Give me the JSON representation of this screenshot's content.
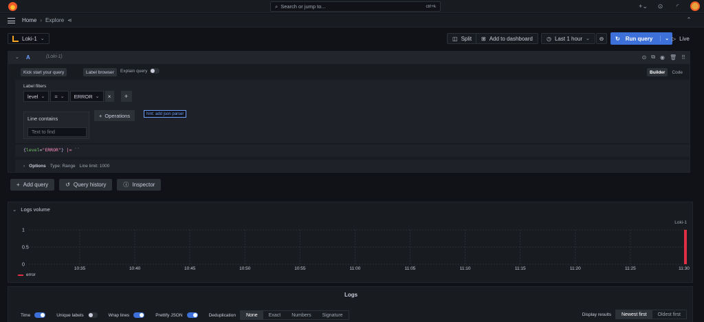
{
  "topbar": {
    "search_placeholder": "Search or jump to...",
    "shortcut": "ctrl+k",
    "icons": [
      "grafana-logo-icon",
      "plus-icon",
      "help-icon",
      "rss-icon",
      "avatar"
    ]
  },
  "breadcrumbs": {
    "home": "Home",
    "sep": "›",
    "current": "Explore"
  },
  "toolbar": {
    "datasource": "Loki-1",
    "split": "Split",
    "add_to_dashboard": "Add to dashboard",
    "time_range": "Last 1 hour",
    "run_query": "Run query",
    "live": "Live"
  },
  "query": {
    "ref": "A",
    "source": "(Loki-1)",
    "kick_start": "Kick start your query",
    "label_browser": "Label browser",
    "explain": "Explain query",
    "mode_builder": "Builder",
    "mode_code": "Code",
    "label_filters_title": "Label filters",
    "filter": {
      "label": "level",
      "operator": "=",
      "value": "ERROR"
    },
    "line_contains_title": "Line contains",
    "line_contains_placeholder": "Text to find",
    "operations": "Operations",
    "hint": "hint: add json parser",
    "text": {
      "open": "{",
      "key": "level",
      "eq": "=",
      "val": "\"ERROR\"",
      "close": "}",
      "op": " |= ",
      "lit": "``"
    },
    "options_label": "Options",
    "options_type": "Type: Range",
    "options_limit": "Line limit: 1000"
  },
  "actions": {
    "add_query": "Add query",
    "query_history": "Query history",
    "inspector": "Inspector"
  },
  "logs_volume": {
    "title": "Logs volume",
    "series_label": "Loki-1"
  },
  "chart_data": {
    "type": "bar",
    "x": [
      "10:35",
      "10:40",
      "10:45",
      "10:50",
      "10:55",
      "11:00",
      "11:05",
      "11:10",
      "11:15",
      "11:20",
      "11:25",
      "11:30"
    ],
    "y_ticks": [
      "1",
      "0.5",
      "0"
    ],
    "ylim": [
      0,
      1
    ],
    "series": [
      {
        "name": "error",
        "color": "#e02f44",
        "points": [
          {
            "x": "11:30",
            "y": 1
          }
        ]
      }
    ]
  },
  "logs": {
    "title": "Logs",
    "time": "Time",
    "unique_labels": "Unique labels",
    "wrap_lines": "Wrap lines",
    "prettify_json": "Prettify JSON",
    "deduplication": "Deduplication",
    "dedup_options": [
      "None",
      "Exact",
      "Numbers",
      "Signature"
    ],
    "display_results": "Display results",
    "order_options": [
      "Newest first",
      "Oldest first"
    ]
  }
}
